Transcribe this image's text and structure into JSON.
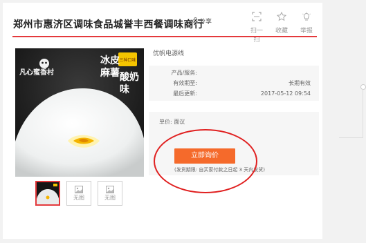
{
  "page": {
    "title": "郑州市惠济区调味食品城誉丰西餐调味商行",
    "share_label": "分享"
  },
  "tools": [
    {
      "label": "扫一扫",
      "icon": "qr-scan-icon"
    },
    {
      "label": "收藏",
      "icon": "star-icon"
    },
    {
      "label": "举报",
      "icon": "report-bulb-icon"
    }
  ],
  "product_image": {
    "brand_text": "凡心蜜香村",
    "badge": "三种口味",
    "flavor_left": [
      "冰皮",
      "麻薯"
    ],
    "flavor_right": [
      "酸奶",
      "味"
    ]
  },
  "thumbnails": [
    {
      "label": "",
      "active": true
    },
    {
      "label": "无图",
      "active": false
    },
    {
      "label": "无图",
      "active": false
    }
  ],
  "info": {
    "seller": "优帆电源线",
    "rows": [
      {
        "key": "产品/服务:",
        "value": ""
      },
      {
        "key": "有效期至:",
        "value": "长期有效"
      },
      {
        "key": "最后更新:",
        "value": "2017-05-12 09:54"
      }
    ]
  },
  "price": {
    "label": "单价: 面议",
    "button_label": "立即询价",
    "delivery_note": "(发货期限: 自买家付款之日起  3  天内发货)"
  },
  "colors": {
    "accent_red": "#e4393c",
    "button_orange": "#f56a2b",
    "annotation_red": "#e02020"
  }
}
